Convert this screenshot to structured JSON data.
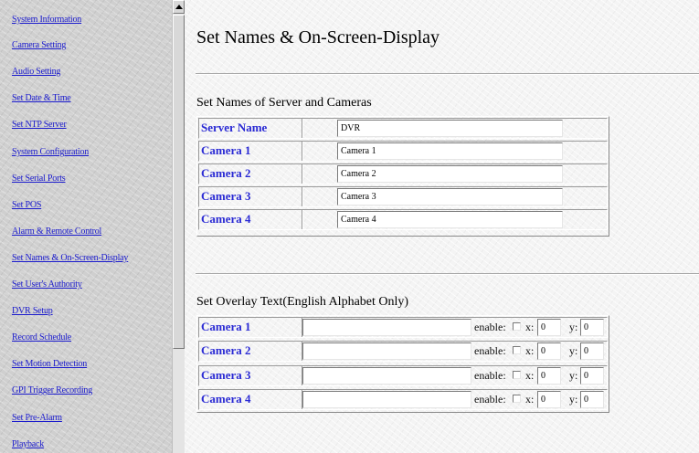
{
  "nav": {
    "items": [
      "System Information",
      "Camera Setting",
      "Audio Setting",
      "Set Date & Time",
      "Set NTP Server",
      "System Configuration",
      "Set Serial Ports",
      "Set POS",
      "Alarm & Remote Control",
      "Set Names & On-Screen-Display",
      "Set User's Authority",
      "DVR Setup",
      "Record Schedule",
      "Set Motion Detection",
      "GPI Trigger Recording",
      "Set Pre-Alarm",
      "Playback"
    ]
  },
  "page": {
    "title": "Set Names & On-Screen-Display"
  },
  "names": {
    "heading": "Set Names of Server and Cameras",
    "rows": [
      {
        "label": "Server Name",
        "value": "DVR"
      },
      {
        "label": "Camera 1",
        "value": "Camera 1"
      },
      {
        "label": "Camera 2",
        "value": "Camera 2"
      },
      {
        "label": "Camera 3",
        "value": "Camera 3"
      },
      {
        "label": "Camera 4",
        "value": "Camera 4"
      }
    ]
  },
  "overlay": {
    "heading": "Set Overlay Text(English Alphabet Only)",
    "enable_label": "enable:",
    "x_label": "x:",
    "y_label": "y:",
    "rows": [
      {
        "label": "Camera 1",
        "text": "",
        "enabled": false,
        "x": "0",
        "y": "0"
      },
      {
        "label": "Camera 2",
        "text": "",
        "enabled": false,
        "x": "0",
        "y": "0"
      },
      {
        "label": "Camera 3",
        "text": "",
        "enabled": false,
        "x": "0",
        "y": "0"
      },
      {
        "label": "Camera 4",
        "text": "",
        "enabled": false,
        "x": "0",
        "y": "0"
      }
    ]
  }
}
